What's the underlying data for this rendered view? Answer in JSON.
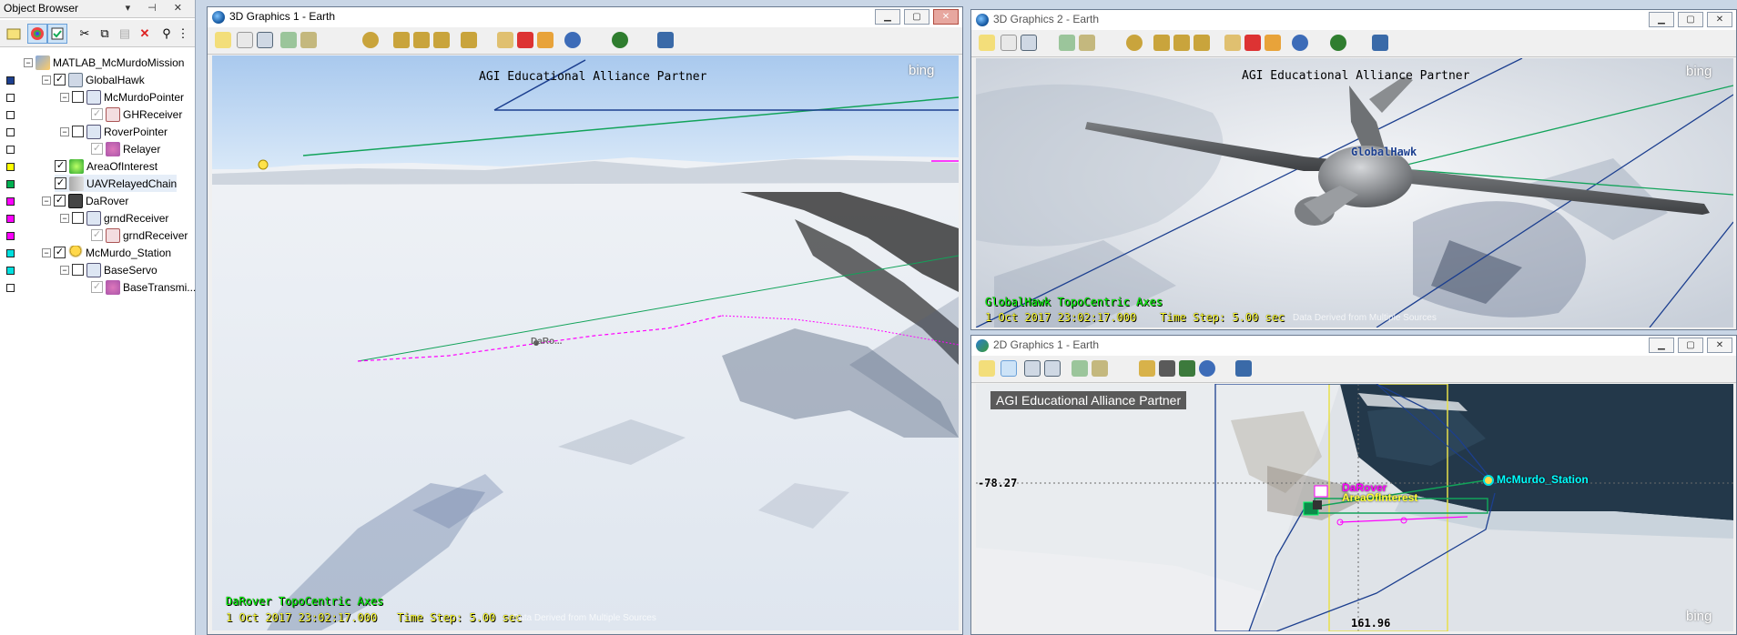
{
  "object_browser": {
    "title": "Object Browser",
    "tree": [
      {
        "label": "MATLAB_McMurdoMission",
        "color": ""
      },
      {
        "label": "GlobalHawk",
        "color": "#1c3f8f"
      },
      {
        "label": "McMurdoPointer",
        "color": "#ffffff"
      },
      {
        "label": "GHReceiver",
        "color": "#ffffff"
      },
      {
        "label": "RoverPointer",
        "color": "#ffffff"
      },
      {
        "label": "Relayer",
        "color": "#ffffff"
      },
      {
        "label": "AreaOfInterest",
        "color": "#ffff00"
      },
      {
        "label": "UAVRelayedChain",
        "color": "#00b050"
      },
      {
        "label": "DaRover",
        "color": "#ff00ff"
      },
      {
        "label": "grndReceiver",
        "color": "#ff00ff"
      },
      {
        "label": "grndReceiver",
        "color": "#ff00ff"
      },
      {
        "label": "McMurdo_Station",
        "color": "#00e0e0"
      },
      {
        "label": "BaseServo",
        "color": "#00e0e0"
      },
      {
        "label": "BaseTransmi...",
        "color": "#ffffff"
      }
    ]
  },
  "window_3d1": {
    "title": "3D Graphics 1 - Earth",
    "partner": "AGI Educational Alliance Partner",
    "bing": "bing",
    "axes_label": "DaRover TopoCentric Axes",
    "time": "1 Oct 2017 23:02:17.000",
    "timestep": "Time Step: 5.00 sec",
    "attribution": "Data Derived from Multiple Sources",
    "object_label": "DaRo..."
  },
  "window_3d2": {
    "title": "3D Graphics 2 - Earth",
    "partner": "AGI Educational Alliance Partner",
    "bing": "bing",
    "axes_label": "GlobalHawk TopoCentric Axes",
    "time": "1 Oct 2017 23:02:17.000",
    "timestep": "Time Step: 5.00 sec",
    "attribution": "Data Derived from Multiple Sources",
    "object_label": "GlobalHawk"
  },
  "window_2d1": {
    "title": "2D Graphics 1 - Earth",
    "partner": "AGI Educational Alliance Partner",
    "bing": "bing",
    "lat_label": "-78.27",
    "lon_label": "161.96",
    "label_rover": "DaRover",
    "label_area": "AreaOfInterest",
    "label_station": "McMurdo_Station"
  },
  "colors": {
    "globalhawk": "#1c3f8f",
    "chain": "#00b050",
    "rover": "#ff00ff",
    "station": "#00e0e0",
    "area": "#ffff00"
  }
}
